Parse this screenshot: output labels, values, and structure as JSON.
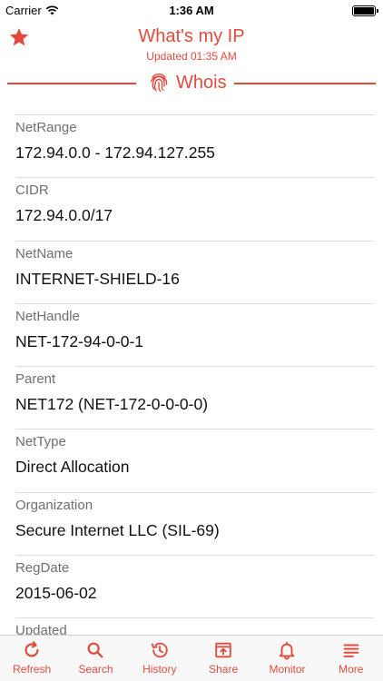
{
  "status_bar": {
    "carrier": "Carrier",
    "time": "1:36 AM",
    "battery_level": 1.0
  },
  "header": {
    "title": "What's my IP",
    "subtitle": "Updated 01:35 AM",
    "favorite_icon": "star-icon"
  },
  "section": {
    "label": "Whois",
    "icon": "fingerprint-icon"
  },
  "whois": [
    {
      "key": "NetRange",
      "value": "172.94.0.0 - 172.94.127.255"
    },
    {
      "key": "CIDR",
      "value": "172.94.0.0/17"
    },
    {
      "key": "NetName",
      "value": "INTERNET-SHIELD-16"
    },
    {
      "key": "NetHandle",
      "value": "NET-172-94-0-0-1"
    },
    {
      "key": "Parent",
      "value": "NET172 (NET-172-0-0-0-0)"
    },
    {
      "key": "NetType",
      "value": "Direct Allocation"
    },
    {
      "key": "Organization",
      "value": "Secure Internet LLC (SIL-69)"
    },
    {
      "key": "RegDate",
      "value": "2015-06-02"
    },
    {
      "key": "Updated",
      "value": ""
    }
  ],
  "tabs": [
    {
      "label": "Refresh",
      "icon": "refresh-icon"
    },
    {
      "label": "Search",
      "icon": "search-icon"
    },
    {
      "label": "History",
      "icon": "history-icon"
    },
    {
      "label": "Share",
      "icon": "share-icon"
    },
    {
      "label": "Monitor",
      "icon": "bell-icon"
    },
    {
      "label": "More",
      "icon": "menu-icon"
    }
  ],
  "colors": {
    "accent": "#e04b3e",
    "label_gray": "#6f6f6f",
    "separator": "#dcdcdc",
    "tab_bar_bg": "#f8f8f8"
  }
}
